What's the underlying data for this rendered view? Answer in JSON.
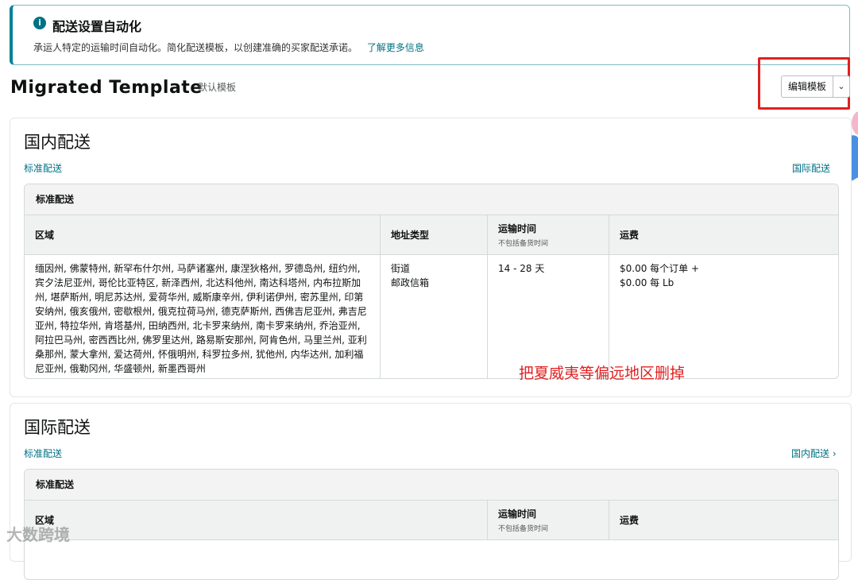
{
  "banner": {
    "title": "配送设置自动化",
    "text": "承运人特定的运输时间自动化。简化配送模板，以创建准确的买家配送承诺。",
    "link": "了解更多信息",
    "icon": "info-icon"
  },
  "header": {
    "title": "Migrated Template",
    "subtitle": "默认模板",
    "edit_label": "编辑模板",
    "dropdown_icon": "chevron-down-icon"
  },
  "domestic": {
    "title": "国内配送",
    "service_link": "标准配送",
    "switch_link": "国际配送",
    "card_title": "标准配送",
    "columns": {
      "region": "区域",
      "address_type": "地址类型",
      "transit": "运输时间",
      "transit_note": "不包括备货时间",
      "fee": "运费"
    },
    "row": {
      "regions": "缅因州, 佛蒙特州, 新罕布什尔州, 马萨诸塞州, 康涅狄格州, 罗德岛州, 纽约州, 宾夕法尼亚州, 哥伦比亚特区, 新泽西州, 北达科他州, 南达科塔州, 内布拉斯加州, 堪萨斯州, 明尼苏达州, 爱荷华州, 威斯康辛州, 伊利诺伊州, 密苏里州, 印第安纳州, 俄亥俄州, 密歇根州, 俄克拉荷马州, 德克萨斯州, 西佛吉尼亚州, 弗吉尼亚州, 特拉华州, 肯塔基州, 田纳西州, 北卡罗来纳州, 南卡罗来纳州, 乔治亚州, 阿拉巴马州, 密西西比州, 佛罗里达州, 路易斯安那州, 阿肯色州, 马里兰州, 亚利桑那州, 蒙大拿州, 爱达荷州, 怀俄明州, 科罗拉多州, 犹他州, 内华达州, 加利福尼亚州, 俄勒冈州, 华盛顿州, 新墨西哥州",
      "address_1": "街道",
      "address_2": "邮政信箱",
      "transit": "14 - 28 天",
      "fee_1": "$0.00 每个订单 +",
      "fee_2": "$0.00 每 Lb"
    }
  },
  "international": {
    "title": "国际配送",
    "service_link": "标准配送",
    "switch_link": "国内配送 ›",
    "card_title": "标准配送",
    "columns": {
      "region": "区域",
      "transit": "运输时间",
      "transit_note": "不包括备货时间",
      "fee": "运费"
    }
  },
  "annotation": "把夏威夷等偏远地区删掉",
  "watermark": "大数跨境",
  "colors": {
    "link": "#007185",
    "annotation": "#e02020",
    "banner_accent": "#008296"
  }
}
